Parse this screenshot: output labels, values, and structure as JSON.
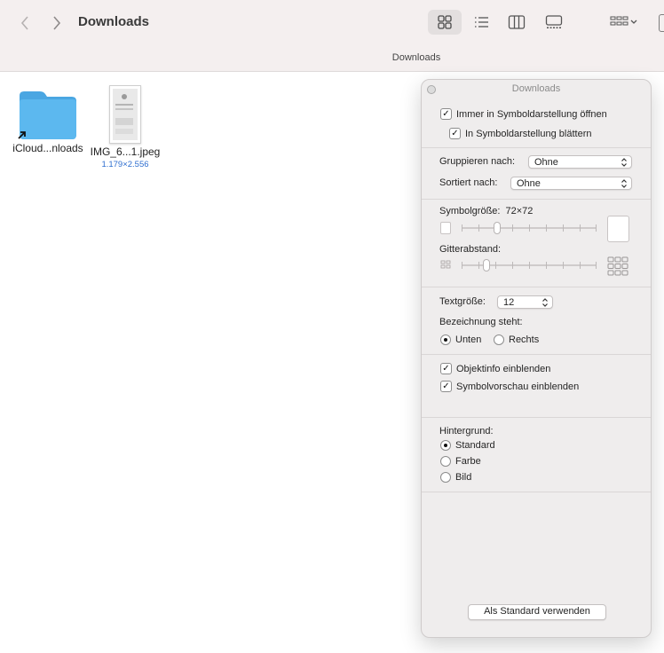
{
  "window": {
    "title": "Downloads",
    "path_label": "Downloads"
  },
  "icons": {
    "back": "chevron-left-icon",
    "forward": "chevron-right-icon",
    "icon_view": "grid-icon",
    "list_view": "list-icon",
    "column_view": "columns-icon",
    "gallery_view": "gallery-icon",
    "group": "group-icon"
  },
  "files": [
    {
      "name": "iCloud...nloads",
      "subtitle": "",
      "kind": "folder-alias"
    },
    {
      "name": "IMG_6...1.jpeg",
      "subtitle": "1.179×2.556",
      "kind": "image"
    }
  ],
  "panel": {
    "title": "Downloads",
    "always_open": "Immer in Symboldarstellung öffnen",
    "browse": "In Symboldarstellung blättern",
    "group_by_label": "Gruppieren nach:",
    "group_by_value": "Ohne",
    "sort_by_label": "Sortiert nach:",
    "sort_by_value": "Ohne",
    "icon_size_label": "Symbolgröße:",
    "icon_size_value": "72×72",
    "icon_size_level": 0.25,
    "grid_spacing_label": "Gitterabstand:",
    "grid_spacing_level": 0.17,
    "text_size_label": "Textgröße:",
    "text_size_value": "12",
    "label_position_label": "Bezeichnung steht:",
    "label_bottom": "Unten",
    "label_right": "Rechts",
    "show_item_info": "Objektinfo einblenden",
    "show_icon_preview": "Symbolvorschau einblenden",
    "background_label": "Hintergrund:",
    "bg_default": "Standard",
    "bg_color": "Farbe",
    "bg_image": "Bild",
    "use_as_defaults": "Als Standard verwenden"
  },
  "colors": {
    "folder": "#5cb8ef",
    "link": "#2f6fd0"
  }
}
